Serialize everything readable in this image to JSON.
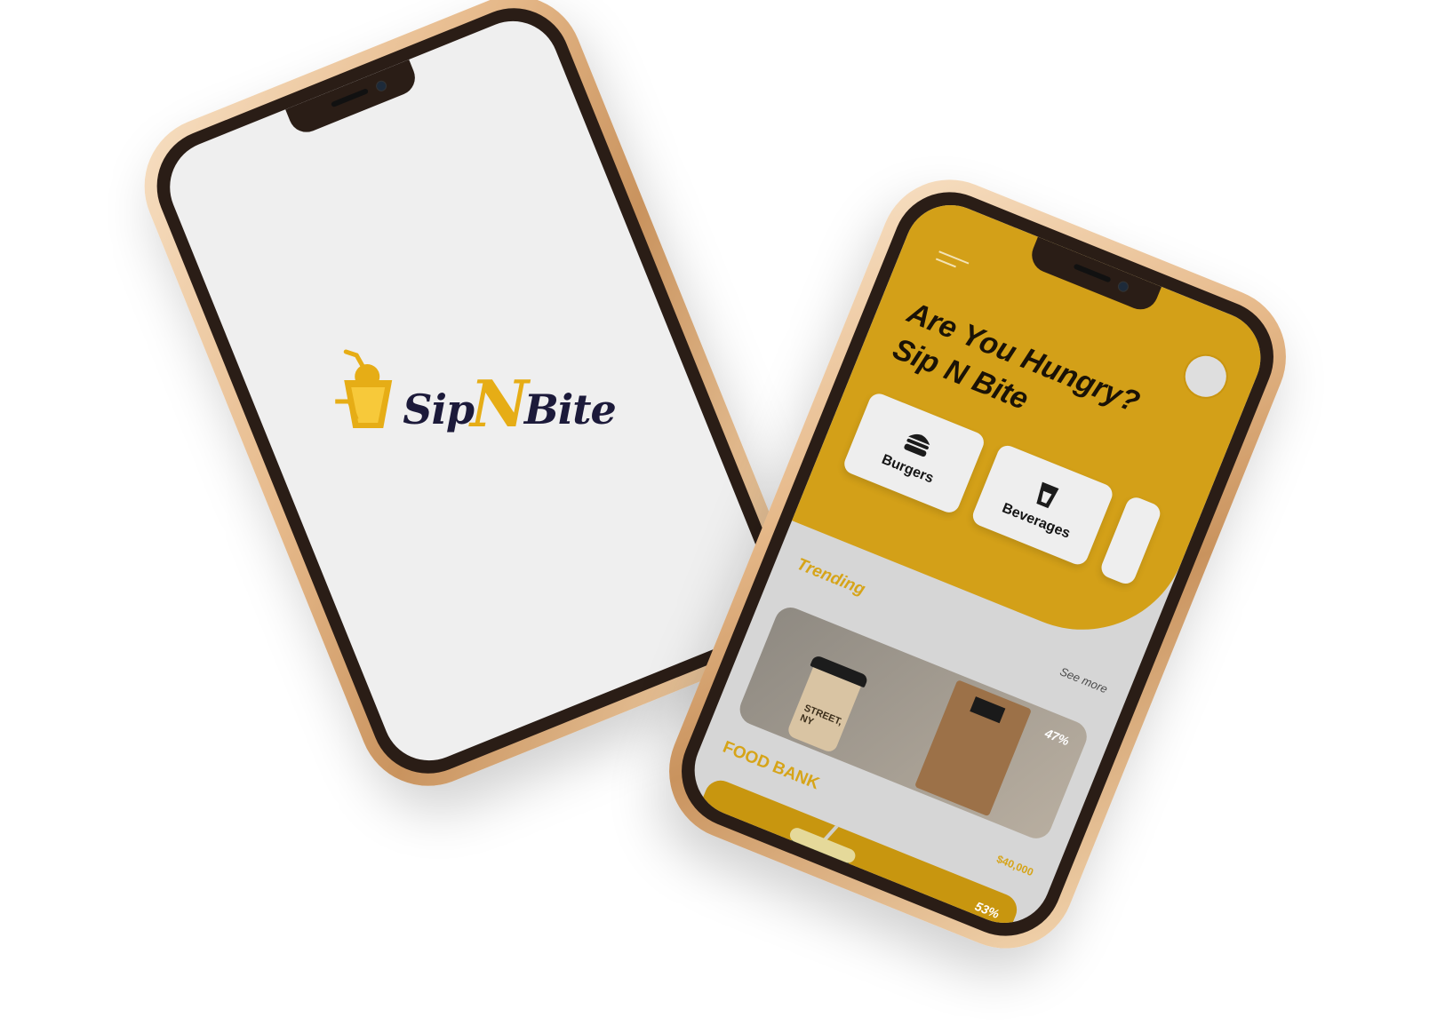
{
  "splash": {
    "logo": {
      "text_pre": "Sip",
      "text_mid": "N",
      "text_post": "Bite"
    }
  },
  "home": {
    "headline_line1": "Are You Hungry?",
    "headline_line2": "Sip N Bite",
    "categories": [
      {
        "label": "Burgers",
        "icon": "burger-icon"
      },
      {
        "label": "Beverages",
        "icon": "beverage-icon"
      }
    ],
    "trending": {
      "title": "Trending",
      "link": "See more"
    },
    "cards": [
      {
        "badge": "47%",
        "cup_text": "STREET, NY"
      },
      {
        "badge": "53%"
      }
    ],
    "food_bank": {
      "title": "FOOD BANK",
      "price": "$40,000"
    }
  },
  "colors": {
    "accent": "#d3a018",
    "frame": "#e6b98a",
    "bezel": "#2a1d16"
  }
}
